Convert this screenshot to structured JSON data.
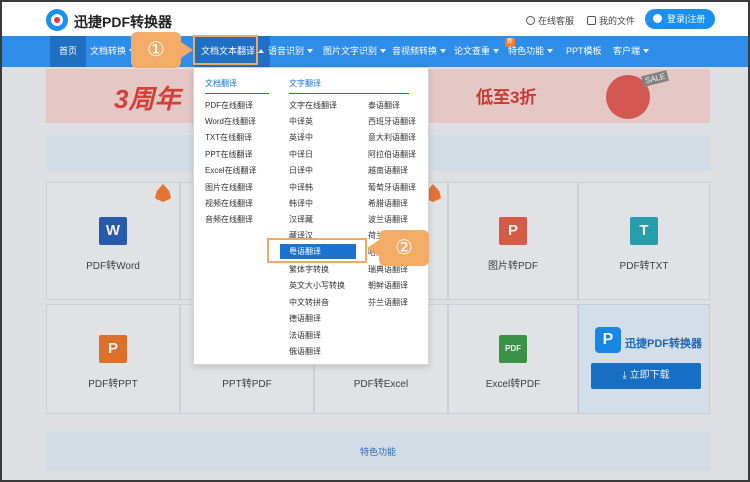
{
  "header": {
    "brand": "迅捷PDF转换器",
    "service": "在线客服",
    "my_files": "我的文件",
    "login": "登录|注册"
  },
  "nav": {
    "items": [
      "首页",
      "文档转换",
      "文档文本翻译",
      "语音识别",
      "图片文字识别",
      "音视频转换",
      "论文查重",
      "特色功能",
      "PPT模板",
      "客户端"
    ],
    "new_badge": "新"
  },
  "banner": {
    "title": "3周年",
    "sub": "低至3折",
    "sale": "SALE"
  },
  "dropdown": {
    "col1_title": "文档翻译",
    "col1": [
      "PDF在线翻译",
      "Word在线翻译",
      "TXT在线翻译",
      "PPT在线翻译",
      "Excel在线翻译",
      "图片在线翻译",
      "视频在线翻译",
      "音频在线翻译"
    ],
    "col2_title": "文字翻译",
    "col2": [
      "文字在线翻译",
      "中译英",
      "英译中",
      "中译日",
      "日译中",
      "中译韩",
      "韩译中",
      "汉译藏",
      "藏译汉",
      "粤语翻译",
      "繁体字转换",
      "英文大小写转换",
      "中文转拼音",
      "德语翻译",
      "法语翻译",
      "俄语翻译"
    ],
    "col3": [
      "泰语翻译",
      "西班牙语翻译",
      "意大利语翻译",
      "阿拉伯语翻译",
      "越南语翻译",
      "葡萄牙语翻译",
      "希腊语翻译",
      "波兰语翻译",
      "荷兰语翻译",
      "哈萨克语翻译",
      "瑞典语翻译",
      "朝鲜语翻译",
      "芬兰语翻译"
    ]
  },
  "tools": {
    "row1": [
      "PDF转Word",
      "",
      "",
      "",
      "图片转PDF",
      "PDF转TXT"
    ],
    "row2": [
      "PDF转PPT",
      "PPT转PDF",
      "PDF转Excel",
      "Excel转PDF"
    ],
    "icons": [
      "W",
      "P",
      "X",
      "PDF",
      "T"
    ]
  },
  "promo": {
    "name": "迅捷PDF转换器",
    "button": "立即下载"
  },
  "features_label": "特色功能",
  "steps": [
    "①",
    "②"
  ],
  "colors": {
    "nav": "#2e8de8",
    "accent": "#1a73d0",
    "highlight": "#f3ac67"
  }
}
